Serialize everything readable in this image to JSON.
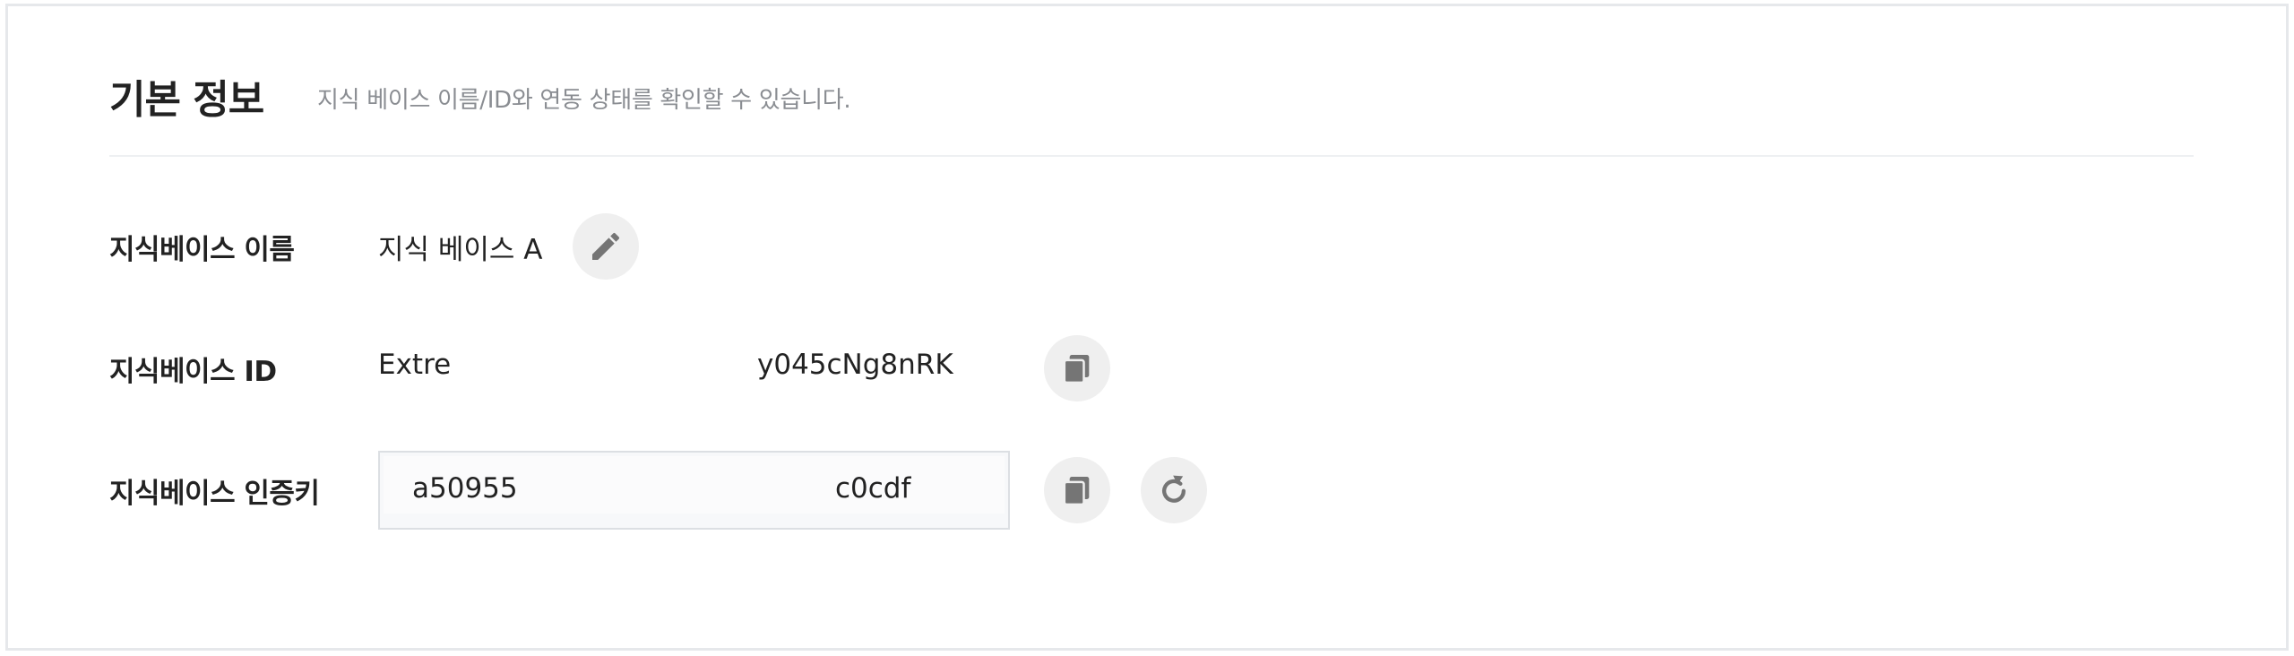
{
  "header": {
    "title": "기본 정보",
    "subtitle": "지식 베이스 이름/ID와 연동 상태를 확인할 수 있습니다."
  },
  "fields": {
    "name": {
      "label": "지식베이스 이름",
      "value": "지식 베이스 A",
      "edit_icon": "pencil-icon"
    },
    "id": {
      "label": "지식베이스 ID",
      "value_prefix": "Extre",
      "value_suffix": "y045cNg8nRK",
      "copy_icon": "copy-icon"
    },
    "auth_key": {
      "label": "지식베이스 인증키",
      "value_prefix": "a50955",
      "value_suffix": "c0cdf",
      "copy_icon": "copy-icon",
      "refresh_icon": "refresh-icon"
    }
  },
  "colors": {
    "icon": "#757575",
    "icon_button_bg": "#efefef",
    "subtitle": "#8a8d92",
    "divider": "#eef0f2",
    "input_border": "#dcdfe3",
    "input_bg": "#f7f8fa"
  }
}
